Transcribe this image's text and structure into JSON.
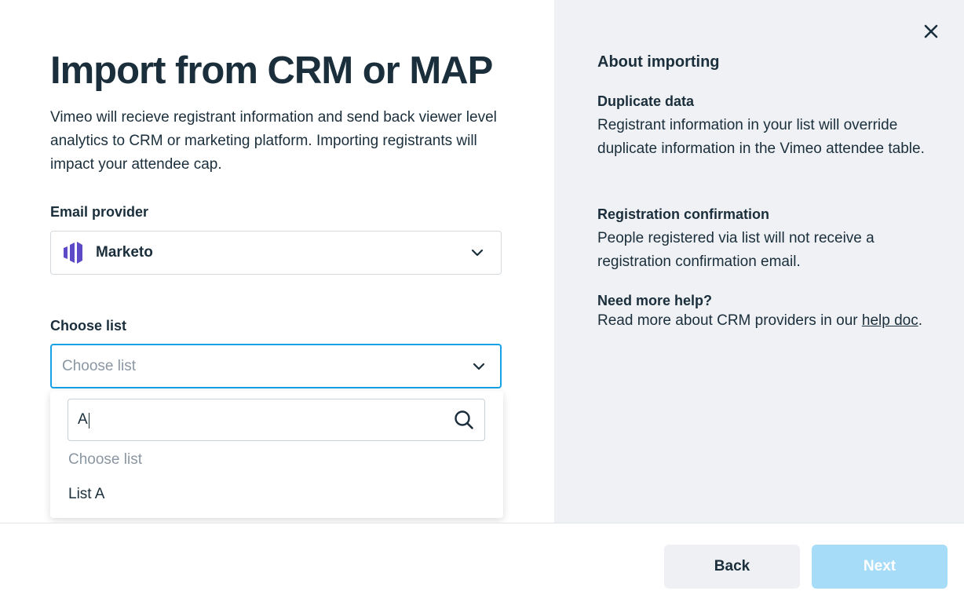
{
  "header": {
    "title": "Import from CRM or MAP",
    "description": "Vimeo will recieve registrant information and send back viewer level analytics to CRM or marketing platform. Importing registrants will impact your attendee cap."
  },
  "email_provider": {
    "label": "Email provider",
    "selected": "Marketo",
    "logo_icon": "marketo-logo-icon",
    "logo_color": "#5c4ac7"
  },
  "choose_list": {
    "label": "Choose list",
    "placeholder": "Choose list",
    "dropdown": {
      "search_value": "A",
      "options": [
        "Choose list",
        "List A"
      ]
    }
  },
  "about": {
    "title": "About importing",
    "sections": [
      {
        "title": "Duplicate data",
        "body": "Registrant information in your list will override duplicate information in the Vimeo attendee table."
      },
      {
        "title": "Registration confirmation",
        "body": "People registered via list will not receive a registration confirmation email."
      },
      {
        "title": "Need more help?",
        "body_prefix": "Read more about CRM providers in our ",
        "link_text": "help doc",
        "body_suffix": "."
      }
    ]
  },
  "footer": {
    "back_label": "Back",
    "next_label": "Next"
  },
  "colors": {
    "accent": "#17a2e5",
    "next_disabled": "#a6dcf7",
    "panel_bg": "#eff1f4",
    "text": "#1a2e3b"
  }
}
